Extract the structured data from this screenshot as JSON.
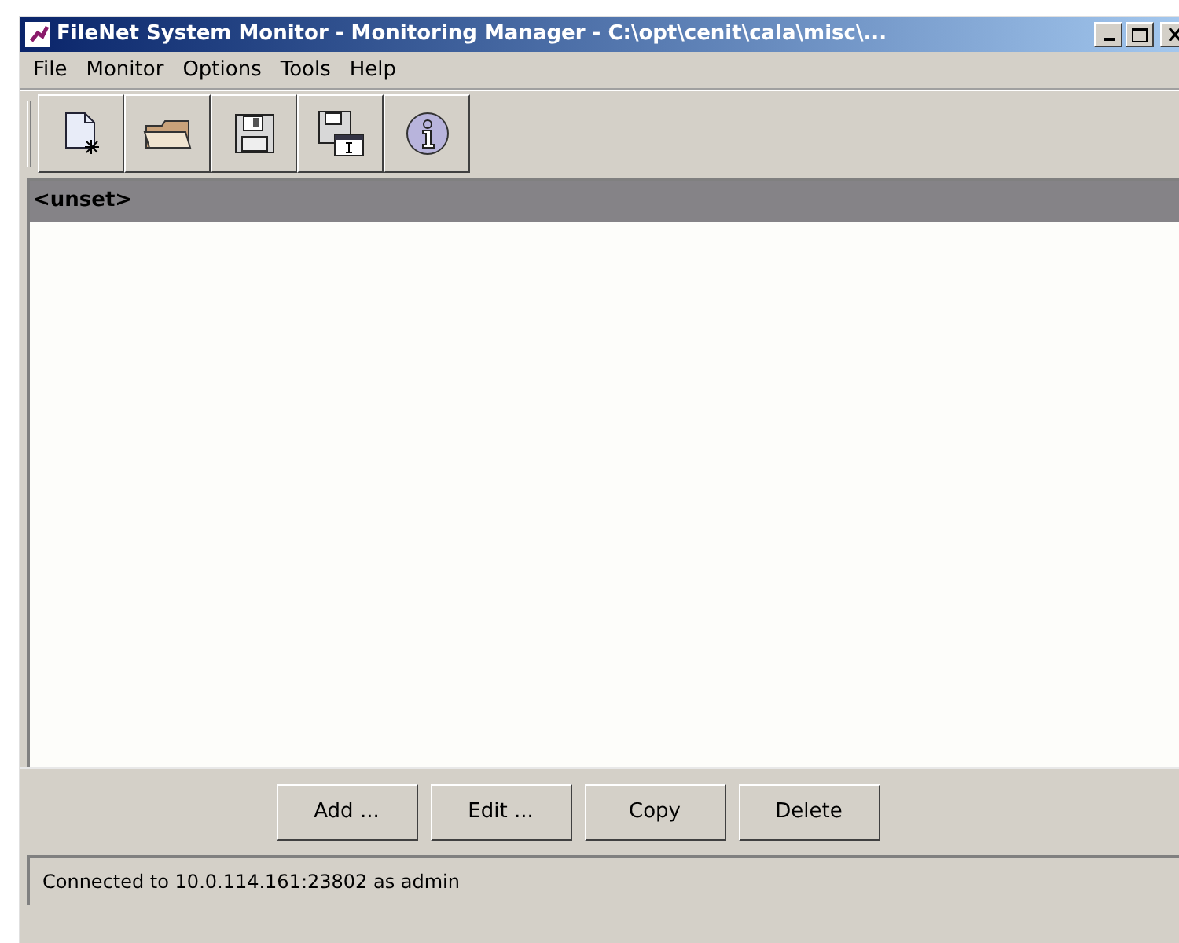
{
  "window": {
    "title": "FileNet System Monitor - Monitoring Manager - C:\\opt\\cenit\\cala\\misc\\..."
  },
  "menu": [
    "File",
    "Monitor",
    "Options",
    "Tools",
    "Help"
  ],
  "toolbar": [
    {
      "kind": "new"
    },
    {
      "kind": "open"
    },
    {
      "kind": "save"
    },
    {
      "kind": "saveas"
    },
    {
      "kind": "info"
    }
  ],
  "list": {
    "header": "<unset>"
  },
  "buttons": [
    "Add ...",
    "Edit ...",
    "Copy",
    "Delete"
  ],
  "status_bar": "Connected to 10.0.114.161:23802 as admin"
}
